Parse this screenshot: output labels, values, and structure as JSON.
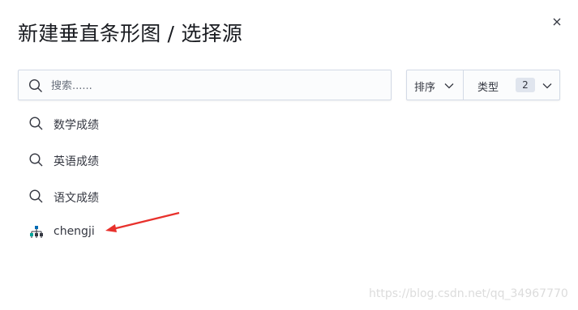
{
  "dialog": {
    "title": "新建垂直条形图 / 选择源"
  },
  "search": {
    "placeholder": "搜索......",
    "value": ""
  },
  "filters": {
    "sort_label": "排序",
    "type_label": "类型",
    "type_count": "2"
  },
  "items": [
    {
      "label": "数学成绩",
      "icon": "search-icon"
    },
    {
      "label": "英语成绩",
      "icon": "search-icon"
    },
    {
      "label": "语文成绩",
      "icon": "search-icon"
    },
    {
      "label": "chengji",
      "icon": "index-pattern-icon"
    }
  ],
  "annotation": {
    "arrow_color": "#e8312c"
  },
  "watermark": "https://blog.csdn.net/qq_34967770",
  "colors": {
    "accent": "#006bb4",
    "text": "#343741",
    "border": "#d3dae6"
  }
}
